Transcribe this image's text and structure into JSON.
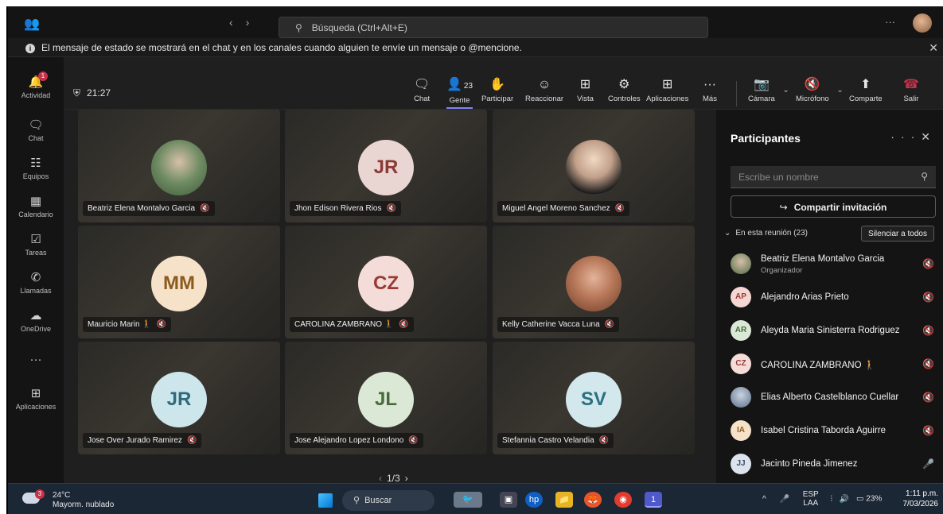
{
  "titlebar": {
    "search_placeholder": "Búsqueda (Ctrl+Alt+E)",
    "back_glyph": "‹",
    "forward_glyph": "›",
    "more_glyph": "···"
  },
  "banner": {
    "text": "El mensaje de estado se mostrará en el chat y en los canales cuando alguien te envíe un mensaje o @mencione."
  },
  "rail": {
    "items": [
      {
        "label": "Actividad",
        "icon": "bell-icon",
        "badge": "1"
      },
      {
        "label": "Chat",
        "icon": "chat-icon"
      },
      {
        "label": "Equipos",
        "icon": "teams-icon"
      },
      {
        "label": "Calendario",
        "icon": "calendar-icon"
      },
      {
        "label": "Tareas",
        "icon": "tasks-icon"
      },
      {
        "label": "Llamadas",
        "icon": "phone-icon"
      },
      {
        "label": "OneDrive",
        "icon": "cloud-icon"
      },
      {
        "label": "",
        "icon": "more-icon"
      },
      {
        "label": "Aplicaciones",
        "icon": "apps-icon"
      }
    ]
  },
  "meeting": {
    "timer": "21:27",
    "participant_count": "23"
  },
  "toolbar": {
    "chat": "Chat",
    "people": "Gente",
    "raise": "Participar",
    "react": "Reaccionar",
    "view": "Vista",
    "controls": "Controles",
    "apps": "Aplicaciones",
    "more": "Más",
    "camera": "Cámara",
    "mic": "Micrófono",
    "share": "Comparte",
    "leave": "Salir"
  },
  "tiles": [
    {
      "name": "Beatriz Elena Montalvo Garcia",
      "initials": "",
      "avatar": "photo",
      "badge": ""
    },
    {
      "name": "Jhon Edison Rivera Rios",
      "initials": "JR",
      "avatar": "initials",
      "color": "#e9d6d3",
      "text_color": "#8b3a35",
      "badge": ""
    },
    {
      "name": "Miguel Angel Moreno Sanchez",
      "initials": "",
      "avatar": "photo2",
      "badge": ""
    },
    {
      "name": "Mauricio Marin",
      "initials": "MM",
      "avatar": "initials",
      "color": "#f6e2c9",
      "text_color": "#8a5a1e",
      "badge": "🚶"
    },
    {
      "name": "CAROLINA ZAMBRANO",
      "initials": "CZ",
      "avatar": "initials",
      "color": "#f4dcd9",
      "text_color": "#9a3a35",
      "badge": "🚶"
    },
    {
      "name": "Kelly Catherine Vacca Luna",
      "initials": "",
      "avatar": "photo3",
      "badge": ""
    },
    {
      "name": "Jose Over Jurado Ramirez",
      "initials": "JR",
      "avatar": "initials",
      "color": "#cde6ec",
      "text_color": "#2f6b7a",
      "badge": ""
    },
    {
      "name": "Jose Alejandro Lopez Londono",
      "initials": "JL",
      "avatar": "initials",
      "color": "#dce8d6",
      "text_color": "#476b3a",
      "badge": ""
    },
    {
      "name": "Stefannia Castro Velandia",
      "initials": "SV",
      "avatar": "initials",
      "color": "#d3e8ec",
      "text_color": "#2a7080",
      "badge": ""
    }
  ],
  "pager": {
    "text": "1/3"
  },
  "panel": {
    "title": "Participantes",
    "search_placeholder": "Escribe un nombre",
    "invite": "Compartir invitación",
    "section": "En esta reunión (23)",
    "mute_all": "Silenciar a todos",
    "people": [
      {
        "name": "Beatriz Elena Montalvo Garcia",
        "role": "Organizador",
        "initials": "",
        "color": "#7a8c6a",
        "fg": "#fff",
        "mic": "muted"
      },
      {
        "name": "Alejandro Arias Prieto",
        "role": "",
        "initials": "AP",
        "color": "#f4d6d3",
        "fg": "#9a3a35",
        "mic": "muted"
      },
      {
        "name": "Aleyda Maria Sinisterra Rodriguez",
        "role": "",
        "initials": "AR",
        "color": "#dce8d6",
        "fg": "#476b3a",
        "mic": "muted"
      },
      {
        "name": "CAROLINA ZAMBRANO",
        "role": "",
        "initials": "CZ",
        "color": "#f4dcd9",
        "fg": "#9a3a35",
        "mic": "muted",
        "badge": "🚶"
      },
      {
        "name": "Elias Alberto Castelblanco Cuellar",
        "role": "",
        "initials": "",
        "color": "#6d7f99",
        "fg": "#fff",
        "mic": "muted"
      },
      {
        "name": "Isabel Cristina Taborda Aguirre",
        "role": "",
        "initials": "IA",
        "color": "#f6e2c9",
        "fg": "#8a5a1e",
        "mic": "muted"
      },
      {
        "name": "Jacinto Pineda Jimenez",
        "role": "",
        "initials": "JJ",
        "color": "#dde3ec",
        "fg": "#3b4d6b",
        "mic": "on"
      }
    ]
  },
  "taskbar": {
    "weather_badge": "3",
    "temp": "24°C",
    "weather": "Mayorm. nublado",
    "search": "Buscar",
    "lang_top": "ESP",
    "lang_bottom": "LAA",
    "battery": "23%",
    "time": "1:11 p.m.",
    "date": "7/03/2026",
    "teams_badge": "1"
  },
  "colors": {
    "accent": "#7f85f5",
    "leave": "#c4314b",
    "background": "#1f1f1f"
  }
}
